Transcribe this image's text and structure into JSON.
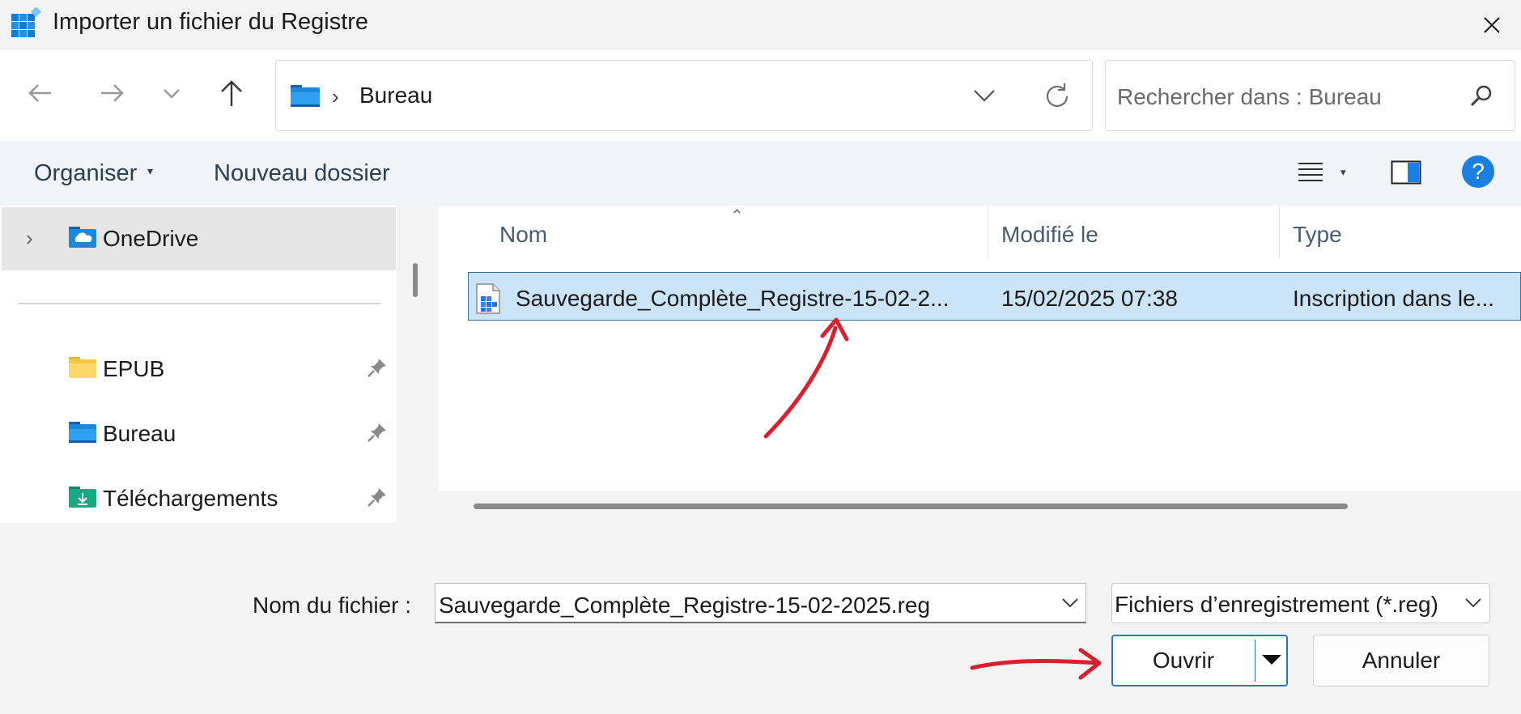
{
  "window": {
    "title": "Importer un fichier du Registre",
    "app_icon": "registry-editor-icon",
    "close_icon": "close-icon"
  },
  "nav": {
    "back_icon": "arrow-left-icon",
    "forward_icon": "arrow-right-icon",
    "recent_icon": "chevron-down-icon",
    "up_icon": "arrow-up-icon",
    "address": {
      "location": "Bureau",
      "folder_icon": "desktop-folder-icon",
      "dropdown_icon": "chevron-down-icon",
      "refresh_icon": "refresh-icon"
    },
    "search": {
      "placeholder": "Rechercher dans : Bureau",
      "icon": "search-icon"
    }
  },
  "commandbar": {
    "organize_label": "Organiser",
    "new_folder_label": "Nouveau dossier",
    "view_icon": "list-view-icon",
    "preview_icon": "preview-pane-icon",
    "help_label": "?"
  },
  "sidebar": {
    "onedrive": {
      "label": "OneDrive",
      "icon": "onedrive-folder-icon"
    },
    "items": [
      {
        "label": "EPUB",
        "icon": "folder-icon",
        "pinned": true
      },
      {
        "label": "Bureau",
        "icon": "desktop-folder-icon",
        "pinned": true
      },
      {
        "label": "Téléchargements",
        "icon": "downloads-folder-icon",
        "pinned": true
      }
    ]
  },
  "filelist": {
    "columns": [
      "Nom",
      "Modifié le",
      "Type"
    ],
    "sort_column": "Nom",
    "rows": [
      {
        "name": "Sauvegarde_Complète_Registre-15-02-2...",
        "modified": "15/02/2025 07:38",
        "type": "Inscription dans le...",
        "icon": "registry-file-icon",
        "selected": true
      }
    ]
  },
  "footer": {
    "filename_label": "Nom du fichier :",
    "filename_value": "Sauvegarde_Complète_Registre-15-02-2025.reg",
    "filetype_value": "Fichiers d’enregistrement (*.reg)",
    "open_label": "Ouvrir",
    "cancel_label": "Annuler"
  },
  "colors": {
    "selection": "#cce4f7",
    "accent": "#2a73c5",
    "annotation": "#d8202e"
  }
}
